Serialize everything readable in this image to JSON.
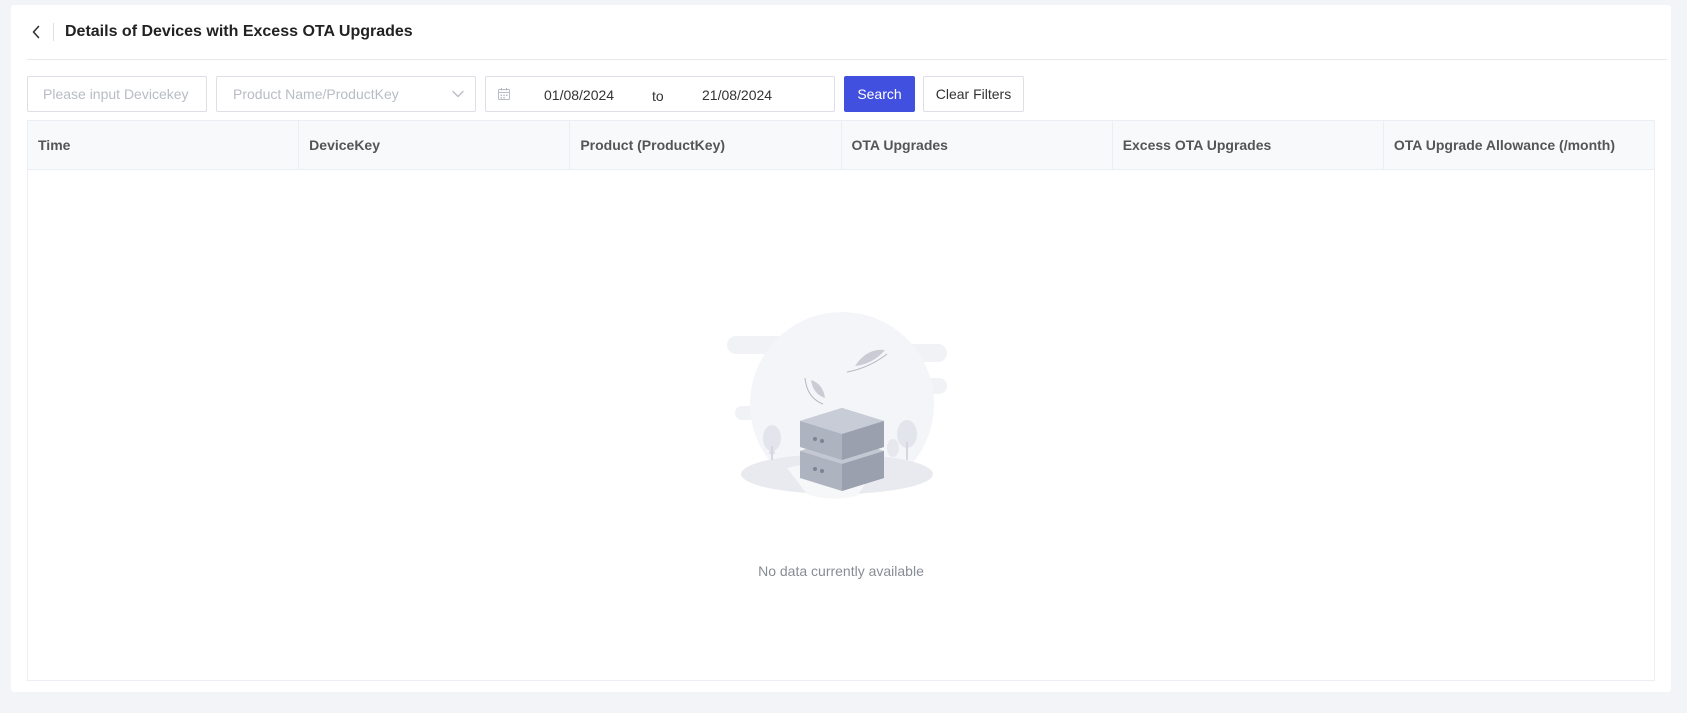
{
  "header": {
    "back_icon": "chevron-left-icon",
    "title": "Details of Devices with Excess OTA Upgrades"
  },
  "filters": {
    "device_key_placeholder": "Please input Devicekey",
    "product_placeholder": "Product Name/ProductKey",
    "date_start": "01/08/2024",
    "date_separator": "to",
    "date_end": "21/08/2024",
    "search_label": "Search",
    "clear_label": "Clear Filters"
  },
  "table": {
    "columns": [
      "Time",
      "DeviceKey",
      "Product (ProductKey)",
      "OTA Upgrades",
      "Excess OTA Upgrades",
      "OTA Upgrade Allowance (/month)"
    ],
    "rows": [],
    "empty_text": "No data currently available"
  },
  "colors": {
    "primary": "#4250e0",
    "page_background": "#f3f4f7",
    "header_background": "#f8f9fb"
  }
}
